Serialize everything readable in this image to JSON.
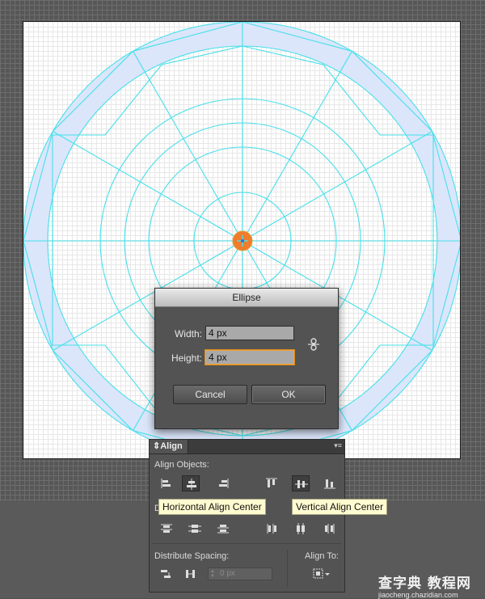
{
  "dialog": {
    "title": "Ellipse",
    "width_label": "Width:",
    "width_value": "4 px",
    "height_label": "Height:",
    "height_value": "4 px",
    "link_icon": "constrain-proportions-icon",
    "cancel_label": "Cancel",
    "ok_label": "OK"
  },
  "align_panel": {
    "tab_label": "Align",
    "align_objects_label": "Align Objects:",
    "distribute_objects_label": "D",
    "distribute_spacing_label": "Distribute Spacing:",
    "align_to_label": "Align To:",
    "spacing_value": "0 px"
  },
  "tooltips": {
    "horizontal": "Horizontal Align Center",
    "vertical": "Vertical Align Center"
  },
  "watermark": {
    "title": "查字典 教程网",
    "url": "jiaocheng.chazidian.com"
  },
  "colors": {
    "guide": "#46e0ea",
    "band_fill": "#dbe6fb",
    "selected_ellipse": "#f07c2c"
  }
}
